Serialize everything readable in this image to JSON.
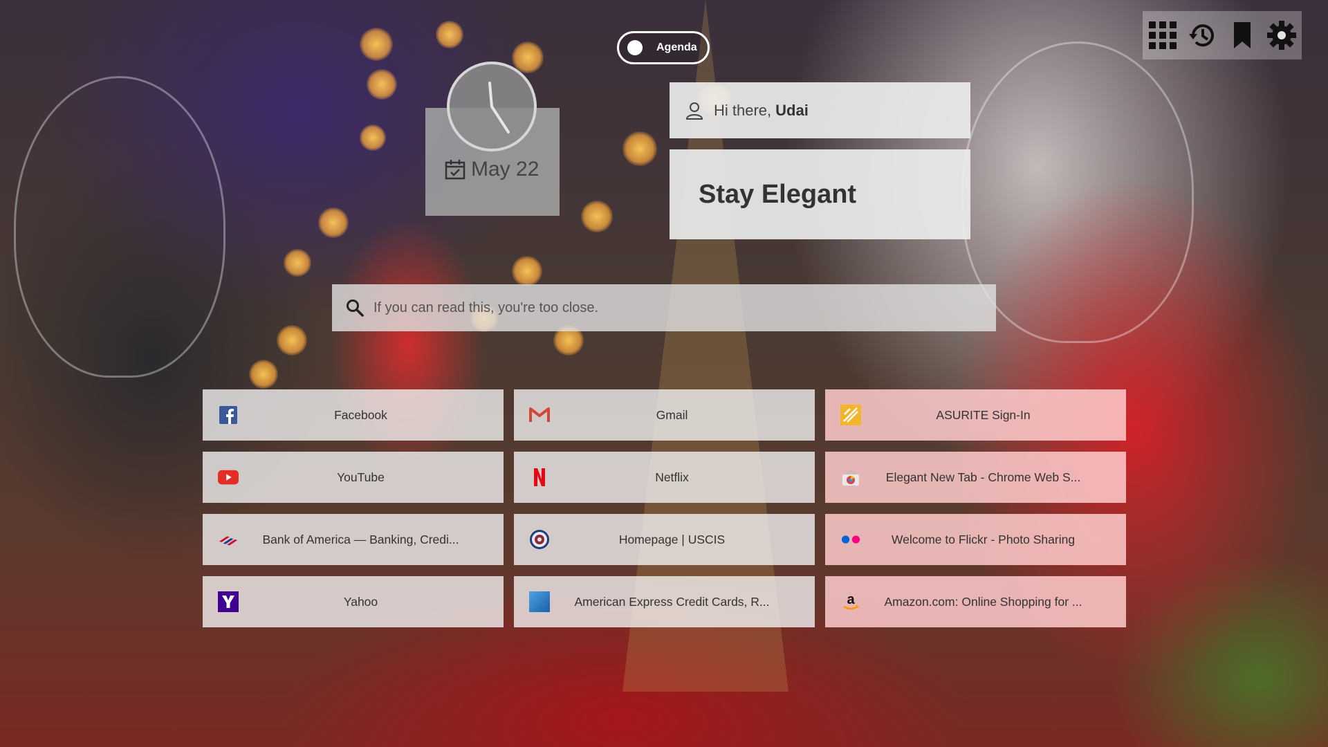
{
  "agenda": {
    "label": "Agenda"
  },
  "clock": {
    "date": "May 22"
  },
  "greeting": {
    "prefix": "Hi there,",
    "name": "Udai"
  },
  "motto": "Stay Elegant",
  "search": {
    "placeholder": "If you can read this, you're too close."
  },
  "toolbar": {
    "items": [
      {
        "icon": "apps-grid-icon"
      },
      {
        "icon": "history-icon"
      },
      {
        "icon": "bookmark-icon"
      },
      {
        "icon": "gear-icon"
      }
    ]
  },
  "shortcuts": [
    {
      "label": "Facebook",
      "icon": "facebook-icon",
      "color": "#3b5998"
    },
    {
      "label": "Gmail",
      "icon": "gmail-icon",
      "color": "#d44638"
    },
    {
      "label": "ASURITE Sign-In",
      "icon": "asu-icon",
      "color": "#f3b52b"
    },
    {
      "label": "YouTube",
      "icon": "youtube-icon",
      "color": "#e52d27"
    },
    {
      "label": "Netflix",
      "icon": "netflix-icon",
      "color": "#e50914"
    },
    {
      "label": "Elegant New Tab - Chrome Web S...",
      "icon": "chrome-web-store-icon",
      "color": "#4285f4"
    },
    {
      "label": "Bank of America — Banking, Credi...",
      "icon": "bank-of-america-icon",
      "color": "#c8102e"
    },
    {
      "label": "Homepage | USCIS",
      "icon": "uscis-seal-icon",
      "color": "#1f3d7a"
    },
    {
      "label": "Welcome to Flickr - Photo Sharing",
      "icon": "flickr-icon",
      "color": "#ff0084"
    },
    {
      "label": "Yahoo",
      "icon": "yahoo-icon",
      "color": "#400090"
    },
    {
      "label": "American Express Credit Cards, R...",
      "icon": "amex-icon",
      "color": "#2e77bc"
    },
    {
      "label": "Amazon.com: Online Shopping for ...",
      "icon": "amazon-icon",
      "color": "#ff9900"
    }
  ]
}
